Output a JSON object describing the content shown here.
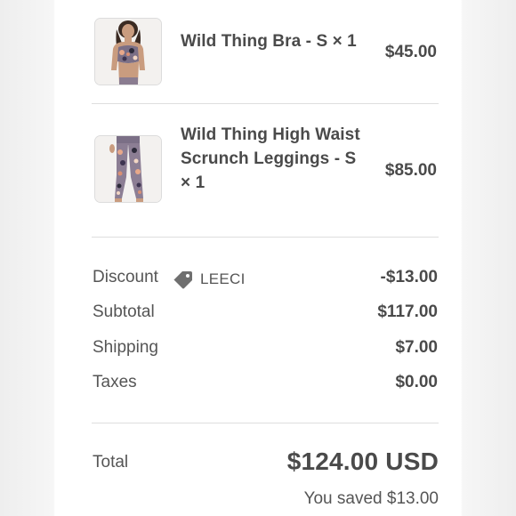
{
  "items": [
    {
      "name": "Wild Thing Bra - S × 1",
      "price": "$45.00",
      "image": "sports-bra-product-photo"
    },
    {
      "name": "Wild Thing High Waist Scrunch Leggings - S × 1",
      "price": "$85.00",
      "image": "leggings-product-photo"
    }
  ],
  "summary": {
    "discount_label": "Discount",
    "discount_code": "LEECI",
    "discount_icon": "tag-icon",
    "discount_value": "-$13.00",
    "subtotal_label": "Subtotal",
    "subtotal_value": "$117.00",
    "shipping_label": "Shipping",
    "shipping_value": "$7.00",
    "taxes_label": "Taxes",
    "taxes_value": "$0.00"
  },
  "total": {
    "label": "Total",
    "value": "$124.00 USD",
    "saved_text": "You saved $13.00"
  },
  "colors": {
    "text": "#4a4a4a",
    "muted_text": "#555555",
    "divider": "#dedede",
    "tag_icon": "#6f6f6f"
  }
}
